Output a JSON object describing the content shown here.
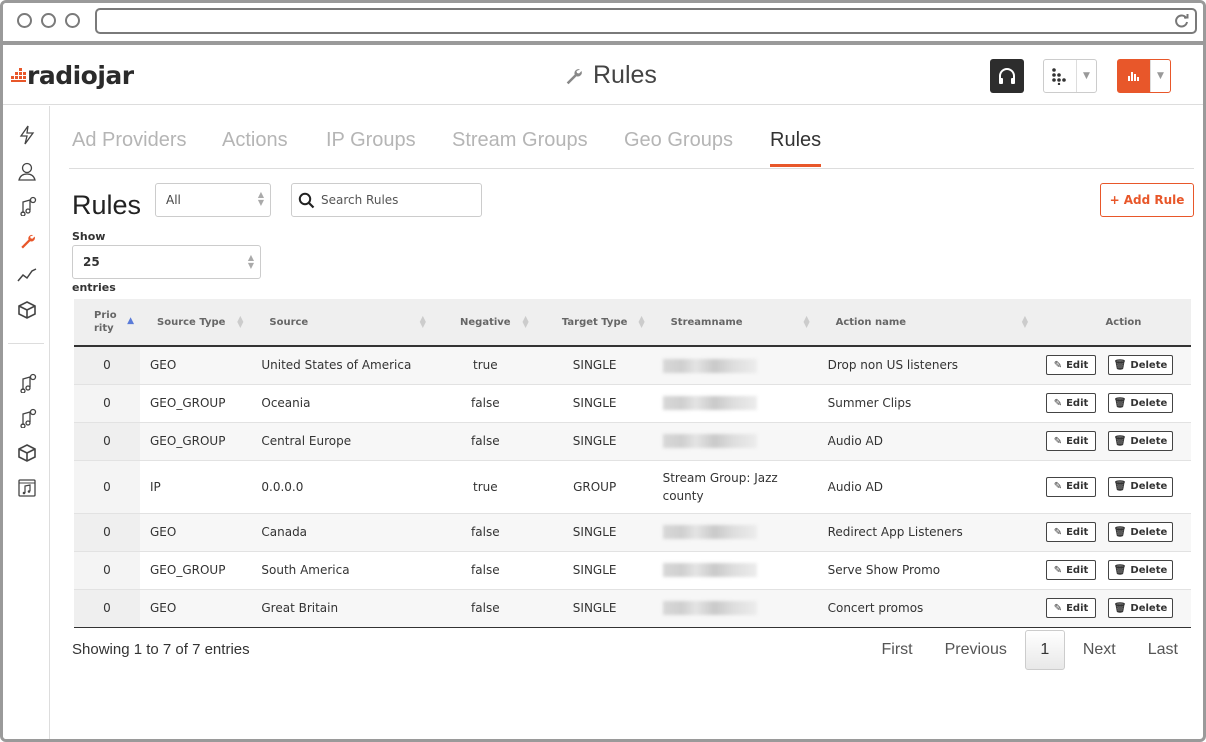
{
  "app": {
    "brand": "radiojar",
    "page_title": "Rules",
    "accent": "#e8572a"
  },
  "tabs": [
    {
      "label": "Ad Providers",
      "active": false
    },
    {
      "label": "Actions",
      "active": false
    },
    {
      "label": "IP Groups",
      "active": false
    },
    {
      "label": "Stream Groups",
      "active": false
    },
    {
      "label": "Geo Groups",
      "active": false
    },
    {
      "label": "Rules",
      "active": true
    }
  ],
  "toolbar": {
    "heading": "Rules",
    "filter_value": "All",
    "search_placeholder": "Search Rules",
    "add_label": "Add Rule",
    "show_label": "Show",
    "entries_value": "25",
    "entries_label": "entries"
  },
  "table": {
    "columns": [
      "Prio rity",
      "Source Type",
      "Source",
      "Negative",
      "Target Type",
      "Streamname",
      "Action name",
      "Action"
    ],
    "rows": [
      {
        "priority": "0",
        "source_type": "GEO",
        "source": "United States of America",
        "negative": "true",
        "target_type": "SINGLE",
        "streamname": "",
        "action_name": "Drop non US listeners"
      },
      {
        "priority": "0",
        "source_type": "GEO_GROUP",
        "source": "Oceania",
        "negative": "false",
        "target_type": "SINGLE",
        "streamname": "",
        "action_name": "Summer Clips"
      },
      {
        "priority": "0",
        "source_type": "GEO_GROUP",
        "source": "Central Europe",
        "negative": "false",
        "target_type": "SINGLE",
        "streamname": "",
        "action_name": "Audio AD"
      },
      {
        "priority": "0",
        "source_type": "IP",
        "source": "0.0.0.0",
        "negative": "true",
        "target_type": "GROUP",
        "streamname": "Stream Group: Jazz county",
        "action_name": "Audio AD"
      },
      {
        "priority": "0",
        "source_type": "GEO",
        "source": "Canada",
        "negative": "false",
        "target_type": "SINGLE",
        "streamname": "",
        "action_name": "Redirect App Listeners"
      },
      {
        "priority": "0",
        "source_type": "GEO_GROUP",
        "source": "South America",
        "negative": "false",
        "target_type": "SINGLE",
        "streamname": "",
        "action_name": "Serve Show Promo"
      },
      {
        "priority": "0",
        "source_type": "GEO",
        "source": "Great Britain",
        "negative": "false",
        "target_type": "SINGLE",
        "streamname": "",
        "action_name": "Concert promos"
      }
    ],
    "edit_label": "Edit",
    "delete_label": "Delete"
  },
  "footer": {
    "info": "Showing 1 to 7 of 7 entries",
    "first": "First",
    "previous": "Previous",
    "page": "1",
    "next": "Next",
    "last": "Last"
  }
}
